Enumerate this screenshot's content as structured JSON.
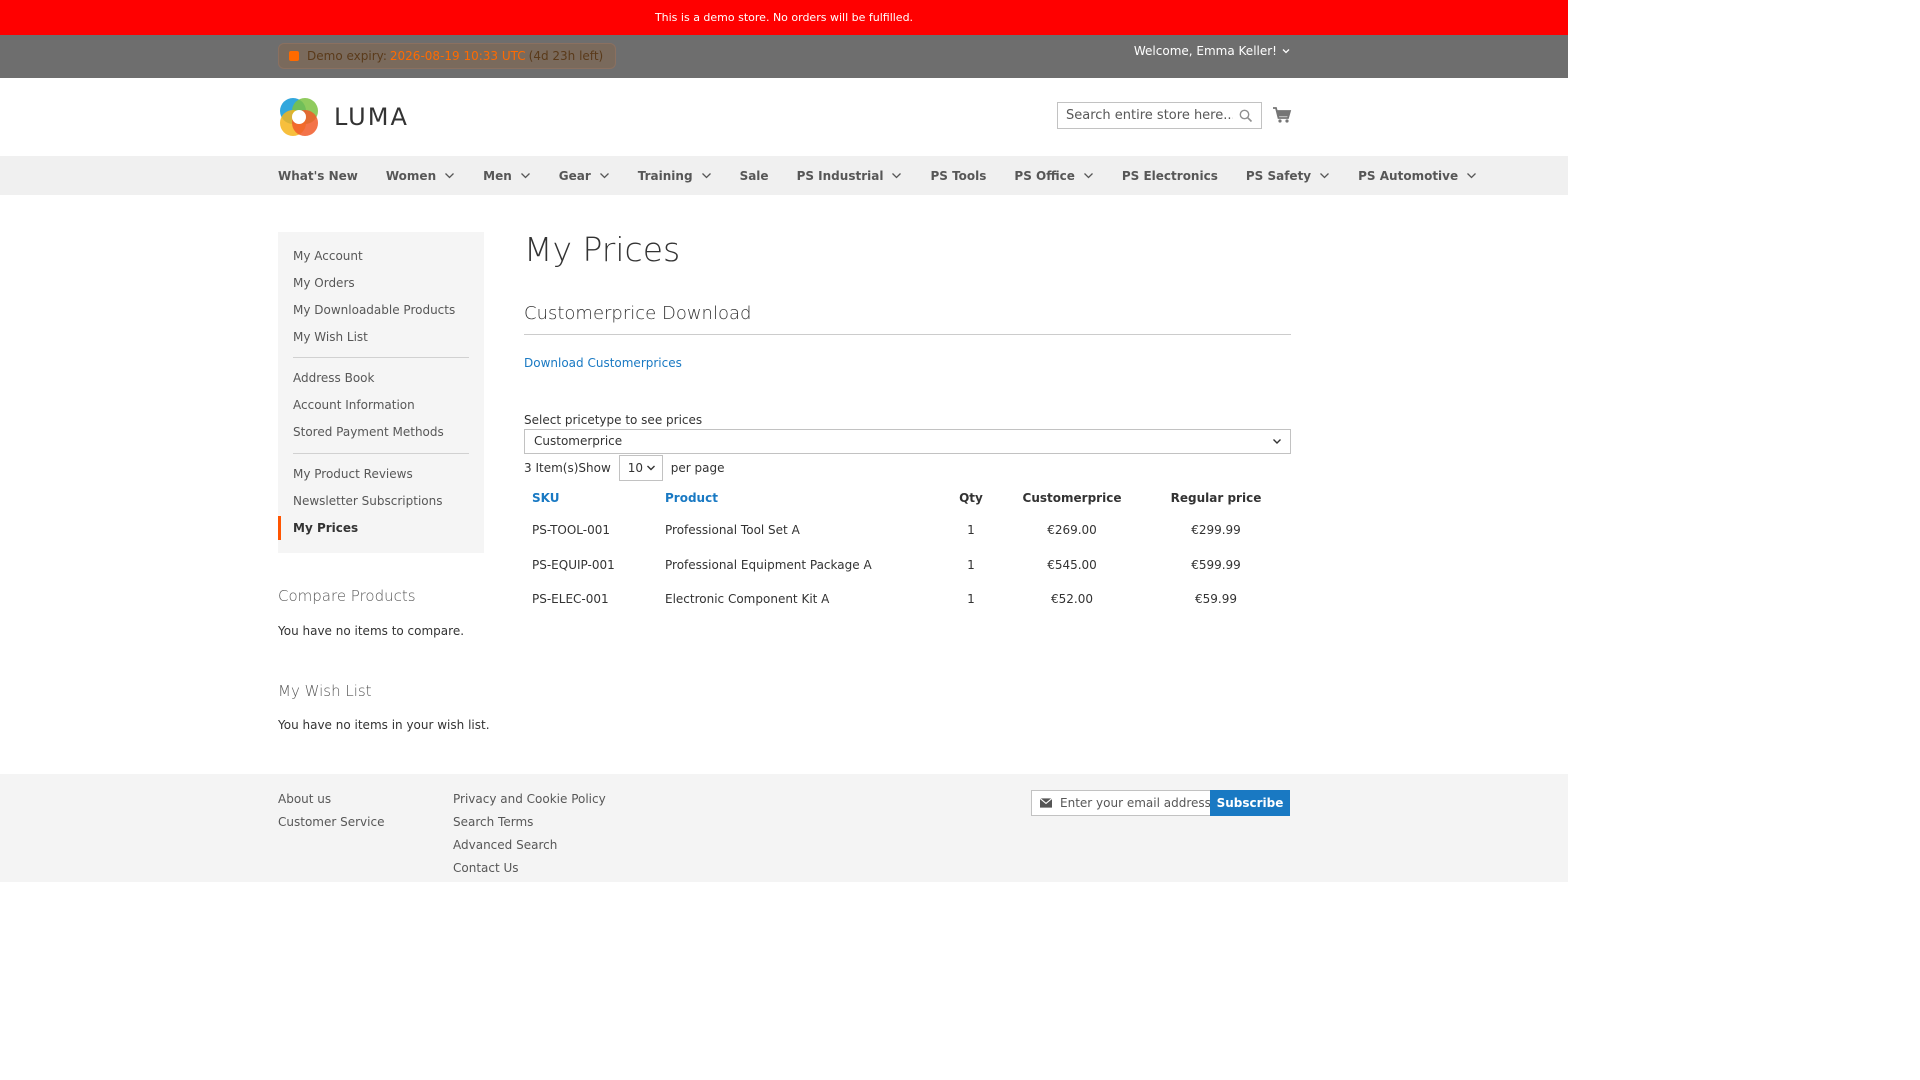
{
  "demo_notice": "This is a demo store. No orders will be fulfilled.",
  "panel": {
    "expiry_label": "Demo expiry:",
    "expiry_date": "2026-08-19 10:33 UTC",
    "expiry_left": "(4d 23h left)",
    "welcome": "Welcome, Emma Keller!"
  },
  "header": {
    "logo_text": "LUMA",
    "search_placeholder": "Search entire store here..."
  },
  "nav": {
    "items": [
      {
        "label": "What's New",
        "dropdown": false
      },
      {
        "label": "Women",
        "dropdown": true
      },
      {
        "label": "Men",
        "dropdown": true
      },
      {
        "label": "Gear",
        "dropdown": true
      },
      {
        "label": "Training",
        "dropdown": true
      },
      {
        "label": "Sale",
        "dropdown": false
      },
      {
        "label": "PS Industrial",
        "dropdown": true
      },
      {
        "label": "PS Tools",
        "dropdown": false
      },
      {
        "label": "PS Office",
        "dropdown": true
      },
      {
        "label": "PS Electronics",
        "dropdown": false
      },
      {
        "label": "PS Safety",
        "dropdown": true
      },
      {
        "label": "PS Automotive",
        "dropdown": true
      }
    ]
  },
  "sidebar": {
    "items": [
      "My Account",
      "My Orders",
      "My Downloadable Products",
      "My Wish List",
      "Address Book",
      "Account Information",
      "Stored Payment Methods",
      "My Product Reviews",
      "Newsletter Subscriptions",
      "My Prices"
    ],
    "active": "My Prices"
  },
  "compare": {
    "title": "Compare Products",
    "empty": "You have no items to compare."
  },
  "wishlist": {
    "title": "My Wish List",
    "empty": "You have no items in your wish list."
  },
  "main": {
    "title": "My Prices",
    "download_title": "Customerprice Download",
    "download_link": "Download Customerprices",
    "select_label": "Select pricetype to see prices",
    "select_value": "Customerprice",
    "items_count": "3 Item(s)",
    "show_label": "Show",
    "limiter_value": "10",
    "per_page": "per page",
    "table": {
      "headers": [
        "SKU",
        "Product",
        "Qty",
        "Customerprice",
        "Regular price"
      ],
      "rows": [
        [
          "PS-TOOL-001",
          "Professional Tool Set A",
          "1",
          "€269.00",
          "€299.99"
        ],
        [
          "PS-EQUIP-001",
          "Professional Equipment Package A",
          "1",
          "€545.00",
          "€599.99"
        ],
        [
          "PS-ELEC-001",
          "Electronic Component Kit A",
          "1",
          "€52.00",
          "€59.99"
        ]
      ]
    }
  },
  "footer": {
    "col1": [
      "About us",
      "Customer Service"
    ],
    "col2": [
      "Privacy and Cookie Policy",
      "Search Terms",
      "Advanced Search",
      "Contact Us"
    ],
    "newsletter_placeholder": "Enter your email address",
    "subscribe_label": "Subscribe"
  },
  "colors": {
    "demo_bar": "#ff0000",
    "panel": "#6e6e6e",
    "link": "#1979c3",
    "active_marker": "#ff5501",
    "expiry_accent": "#ff6a00"
  }
}
